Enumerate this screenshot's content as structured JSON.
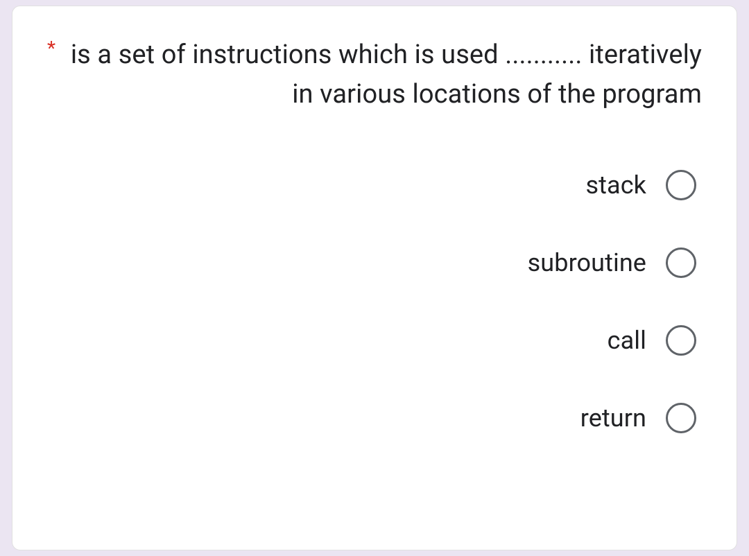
{
  "question": {
    "required_marker": "*",
    "text": "is a set of instructions which is used ........... iteratively in various locations of the program"
  },
  "options": [
    {
      "label": "stack"
    },
    {
      "label": "subroutine"
    },
    {
      "label": "call"
    },
    {
      "label": "return"
    }
  ]
}
